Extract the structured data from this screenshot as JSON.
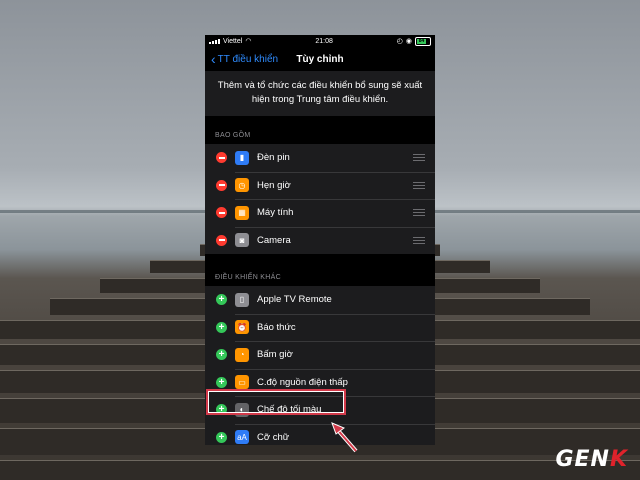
{
  "status": {
    "carrier": "Viettel",
    "time": "21:08",
    "battery": "84"
  },
  "nav": {
    "back_label": "TT điều khiển",
    "title": "Tùy chỉnh"
  },
  "description": "Thêm và tổ chức các điều khiển bổ sung sẽ xuất hiện trong Trung tâm điều khiển.",
  "included": {
    "header": "BAO GỒM",
    "items": [
      {
        "label": "Đèn pin",
        "icon": "flashlight-icon",
        "color": "#2f7cf6"
      },
      {
        "label": "Hẹn giờ",
        "icon": "timer-icon",
        "color": "#ff9500"
      },
      {
        "label": "Máy tính",
        "icon": "calculator-icon",
        "color": "#ff9500"
      },
      {
        "label": "Camera",
        "icon": "camera-icon",
        "color": "#8e8e93"
      }
    ]
  },
  "more": {
    "header": "ĐIỀU KHIỂN KHÁC",
    "items": [
      {
        "label": "Apple TV Remote",
        "icon": "remote-icon",
        "color": "#8e8e93"
      },
      {
        "label": "Báo thức",
        "icon": "alarm-icon",
        "color": "#ff9500"
      },
      {
        "label": "Bấm giờ",
        "icon": "stopwatch-icon",
        "color": "#ff9500"
      },
      {
        "label": "C.độ nguồn điện thấp",
        "icon": "low-power-icon",
        "color": "#ff9500"
      },
      {
        "label": "Chế độ tối màu",
        "icon": "dark-mode-icon",
        "color": "#636366"
      },
      {
        "label": "Cỡ chữ",
        "icon": "text-size-icon",
        "color": "#2f7cf6"
      }
    ]
  },
  "logo": {
    "text": "GENK"
  },
  "colors": {
    "accent": "#2f8cff",
    "remove": "#ff3b30",
    "add": "#34c759",
    "highlight": "#d23a4a"
  }
}
